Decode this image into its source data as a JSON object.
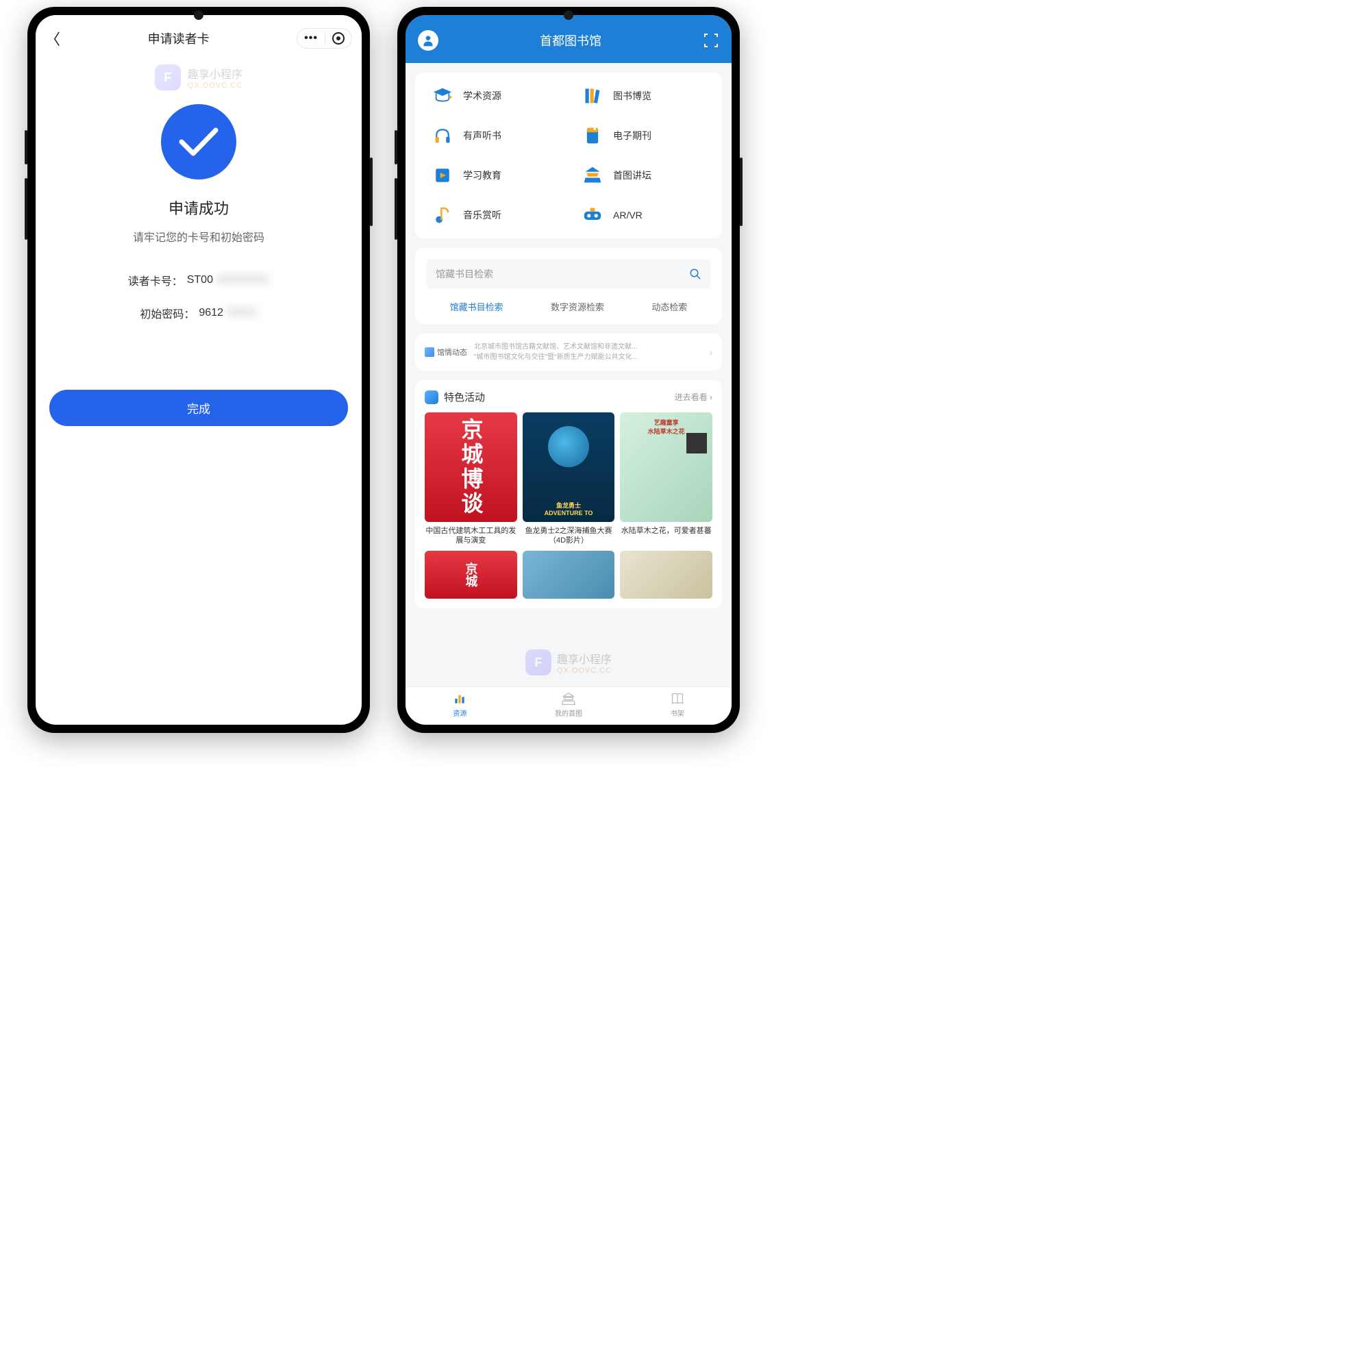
{
  "left": {
    "title": "申请读者卡",
    "watermark": {
      "title": "趣享小程序",
      "sub": "QX.OOVC.CC"
    },
    "success_title": "申请成功",
    "success_sub": "请牢记您的卡号和初始密码",
    "card_label": "读者卡号：",
    "card_value": "ST00",
    "pwd_label": "初始密码：",
    "pwd_value": "9612",
    "complete": "完成"
  },
  "right": {
    "header": "首都图书馆",
    "grid": [
      {
        "label": "学术资源"
      },
      {
        "label": "图书博览"
      },
      {
        "label": "有声听书"
      },
      {
        "label": "电子期刊"
      },
      {
        "label": "学习教育"
      },
      {
        "label": "首图讲坛"
      },
      {
        "label": "音乐赏听"
      },
      {
        "label": "AR/VR"
      }
    ],
    "search_placeholder": "馆藏书目检索",
    "search_tabs": [
      "馆藏书目检索",
      "数字资源检索",
      "动态检索"
    ],
    "news_label": "馆情动态",
    "news_lines": [
      "北京城市图书馆古籍文献馆、艺术文献馆和非遗文献...",
      "\"城市图书馆文化与交往\"暨\"新质生产力赋能公共文化..."
    ],
    "activity_title": "特色活动",
    "see_more": "进去看看",
    "posters": [
      {
        "text": "京城博谈",
        "caption": "中国古代建筑木工工具的发展与演变"
      },
      {
        "subtitle": "ADVENTURE TO",
        "caption": "鱼龙勇士2之深海捕鱼大赛（4D影片）"
      },
      {
        "header": "水陆草木之花",
        "caption": "水陆草木之花，可爱者甚蕃"
      }
    ],
    "tabs": [
      {
        "label": "资源"
      },
      {
        "label": "我的首图"
      },
      {
        "label": "书架"
      }
    ]
  }
}
